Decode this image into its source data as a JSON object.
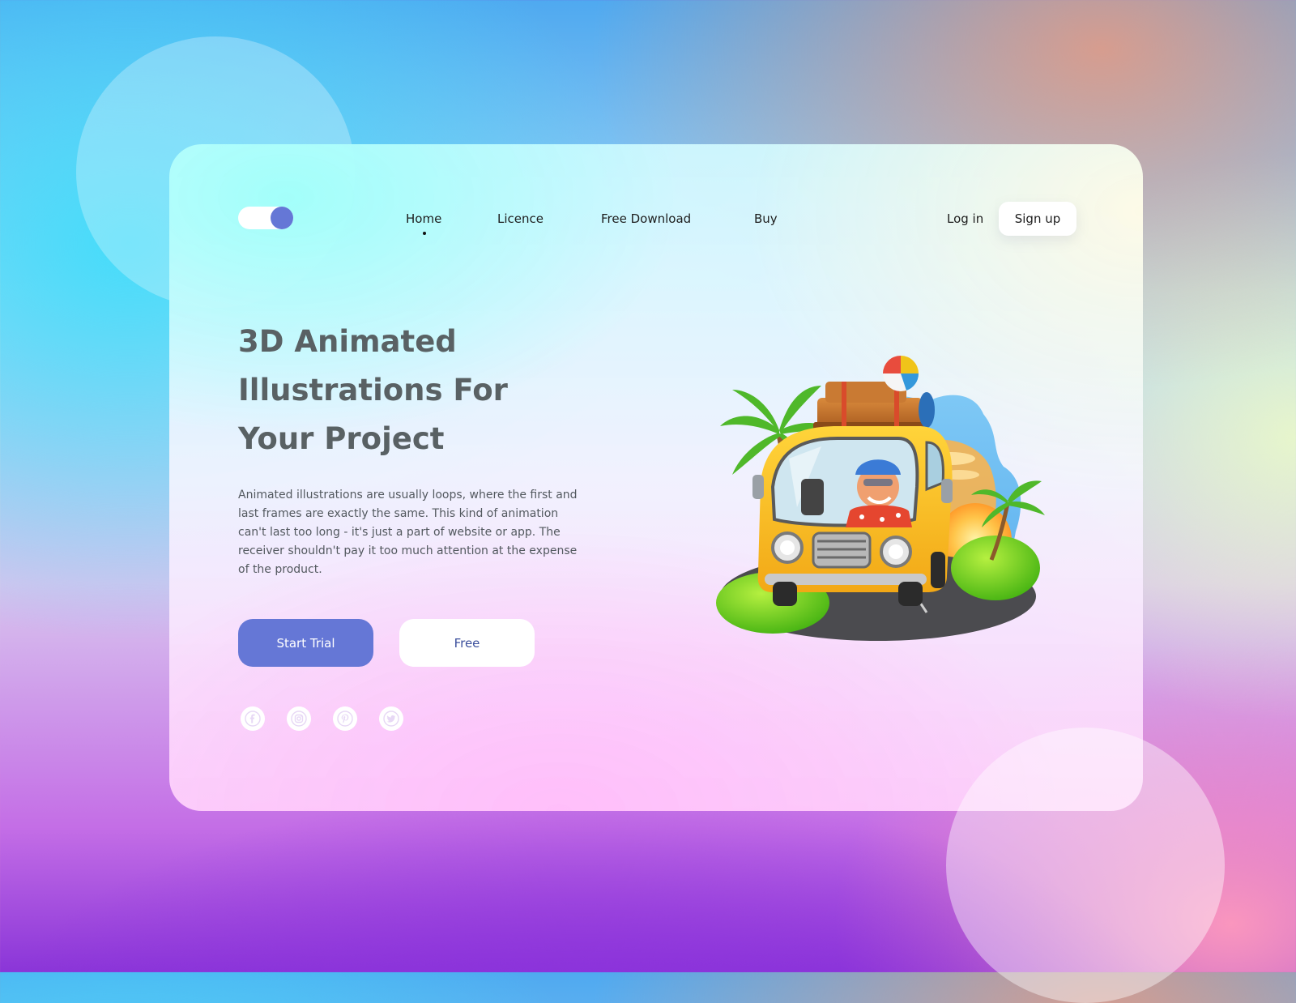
{
  "nav": {
    "links": [
      {
        "label": "Home",
        "active": true
      },
      {
        "label": "Licence",
        "active": false
      },
      {
        "label": "Free Download",
        "active": false
      },
      {
        "label": "Buy",
        "active": false
      }
    ],
    "login_label": "Log in",
    "signup_label": "Sign up",
    "theme_toggle": {
      "on": true
    }
  },
  "hero": {
    "title_lines": [
      "3D Animated",
      "Illustrations For",
      "Your Project"
    ],
    "description": "Animated illustrations are usually loops, where the first and last frames are exactly the same. This kind of animation can't last too long - it's just a part of website or app. The receiver shouldn't pay it too much attention at the expense of the product.",
    "primary_button": "Start Trial",
    "secondary_button": "Free"
  },
  "social_icons": [
    "facebook-icon",
    "instagram-icon",
    "pinterest-icon",
    "twitter-icon"
  ],
  "illustration": "yellow-bus-with-driver-palm-trees",
  "colors": {
    "accent": "#6577d6",
    "title_text": "#596164",
    "body_text": "#53595f",
    "secondary_button_text": "#3b4f9c",
    "card_white": "#ffffff"
  }
}
